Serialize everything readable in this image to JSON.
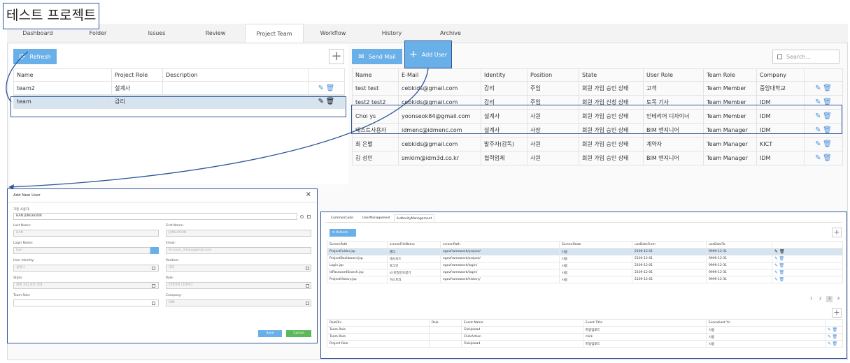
{
  "project_title": "테스트 프로젝트",
  "nav_tabs": [
    "Dashboard",
    "Folder",
    "Issues",
    "Review",
    "Project Team",
    "Workflow",
    "History",
    "Archive"
  ],
  "left": {
    "refresh_label": "Refresh",
    "columns": [
      "Name",
      "Project Role",
      "Description"
    ],
    "rows": [
      {
        "name": "team2",
        "role": "설계사",
        "desc": ""
      },
      {
        "name": "team",
        "role": "감리",
        "desc": ""
      }
    ]
  },
  "right": {
    "send_mail_label": "Send Mail",
    "add_user_label": "Add User",
    "search_placeholder": "Search...",
    "columns": [
      "Name",
      "E-Mail",
      "Identity",
      "Position",
      "State",
      "User Role",
      "Team Role",
      "Company"
    ],
    "rows": [
      [
        "test test",
        "cebkids@gmail.com",
        "감리",
        "주임",
        "회원 가입 승인 상태",
        "고객",
        "Team Member",
        "중앙대학교"
      ],
      [
        "test2 test2",
        "cebkids@gmail.com",
        "감리",
        "주임",
        "회원 가입 신청 상태",
        "토목 기사",
        "Team Member",
        "IDM"
      ],
      [
        "Choi ys",
        "yoonseok84@gmail.com",
        "설계사",
        "사원",
        "회원 가입 승인 상태",
        "인테리어 디자이너",
        "Team Member",
        "IDM"
      ],
      [
        "테스트사용자",
        "idmenc@idmenc.com",
        "설계사",
        "사장",
        "회원 가입 승인 상태",
        "BIM 엔지니어",
        "Team Manager",
        "IDM"
      ],
      [
        "최 은별",
        "cebkids@gmail.com",
        "발주자(감독)",
        "사원",
        "회원 가입 승인 상태",
        "계약자",
        "Team Manager",
        "KICT"
      ],
      [
        "김 성민",
        "smkim@idm3d.co.kr",
        "협력업체",
        "사원",
        "회원 가입 승인 상태",
        "BIM 엔지니어",
        "Team Manager",
        "IDM"
      ]
    ]
  },
  "modal": {
    "title": "Add New User",
    "close": "×",
    "existing_user_label": "기존 사용자:",
    "existing_user_value": "HAN JUNGHOON",
    "last_name_label": "Last Name:",
    "last_name_value": "HAN",
    "first_name_label": "First Name:",
    "first_name_value": "JUNGHOON",
    "login_name_label": "Login Name:",
    "login_name_value": "han",
    "email_label": "Email:",
    "email_value": "Account_mhan@gmail.com",
    "identity_label": "User Identity:",
    "identity_value": "설계사",
    "position_label": "Position:",
    "position_value": "대리",
    "state_label": "State:",
    "state_value": "회원 가입 승인 상태",
    "role_label": "Role:",
    "role_value": "인테리어 디자이너",
    "team_role_label": "Team Role:",
    "company_label": "Company:",
    "company_value": "IDM",
    "save_label": "Save",
    "cancel_label": "Cancel"
  },
  "sub": {
    "tabs": [
      "CommonCode",
      "UserManagement",
      "AuthorityManagement"
    ],
    "refresh_label": "Refresh",
    "columns": [
      "ScreenPath",
      "screenFileName",
      "screenPath",
      "ScreenState",
      "useDateFrom",
      "useDateTo"
    ],
    "rows": [
      [
        "ProjectFolder.jsp",
        "폴더",
        "egovframework/project/",
        "사용",
        "2109-12-01",
        "9999-12-31"
      ],
      [
        "ProjectDashboard.jsp",
        "대시보드",
        "egovframework/project/",
        "사용",
        "2109-12-01",
        "9999-12-31"
      ],
      [
        "Login.jsp",
        "로그인",
        "egovframework/login/",
        "사용",
        "2109-12-01",
        "9999-12-31"
      ],
      [
        "IdPasswordSearch.jsp",
        "id 비밀번호찾기",
        "egovframework/login/",
        "사용",
        "2109-12-01",
        "9999-12-31"
      ],
      [
        "ProjectHistory.jsp",
        "히스토리",
        "egovframework/history/",
        "사용",
        "2109-12-01",
        "9999-12-31"
      ]
    ],
    "pages": [
      "1",
      "2",
      "3",
      "4"
    ],
    "columns2": [
      "RoleDiv",
      "Role",
      "Event Name",
      "Event Title",
      "Executiont Yn"
    ],
    "rows2": [
      [
        "Team Role",
        "",
        "FileUpload",
        "파일업로드",
        "사용"
      ],
      [
        "Team Role",
        "",
        "ClickAction",
        "click",
        "사용"
      ],
      [
        "Project Role",
        "",
        "FileUpload",
        "파일업로드",
        "사용"
      ]
    ]
  }
}
